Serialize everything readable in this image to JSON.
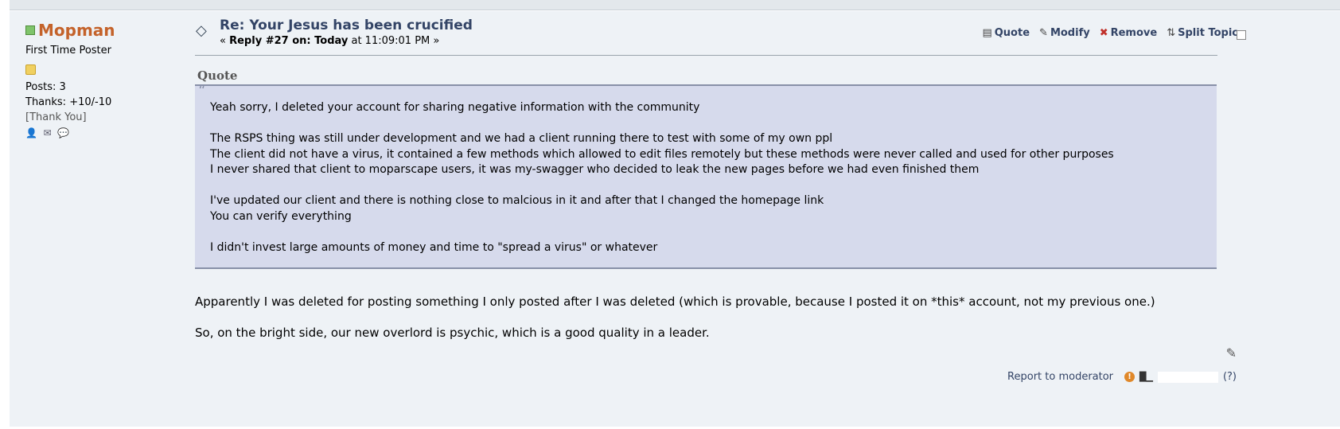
{
  "poster": {
    "name": "Mopman",
    "rank": "First Time Poster",
    "posts": "Posts: 3",
    "thanks": "Thanks: +10/-10",
    "thank_link": "[Thank You]",
    "online_color": "#7fc46b",
    "icons": [
      "profile-icon",
      "email-icon",
      "pm-icon"
    ]
  },
  "header": {
    "subject": "Re: Your Jesus has been crucified",
    "reply_prefix": "«",
    "reply_label": "Reply #27 on: Today",
    "reply_time": "at 11:09:01 PM »"
  },
  "actions": {
    "quote": "Quote",
    "modify": "Modify",
    "remove": "Remove",
    "split": "Split Topic"
  },
  "quote": {
    "header": "Quote",
    "lines": [
      "Yeah sorry, I deleted your account for sharing negative information with the community",
      "",
      "The RSPS thing was still under development and we had a client running there to test with some of my own ppl",
      "The client did not have a virus, it contained a few methods which allowed to edit files remotely but these methods were never called and used for other purposes",
      "I never shared that client to moparscape users, it was my-swagger who decided to leak the new pages before we had even finished them",
      "",
      "I've updated our client and there is nothing close to malcious in it and after that I changed the homepage link",
      "You can verify everything",
      "",
      "I didn't invest large amounts of money and time to \"spread a virus\" or whatever"
    ]
  },
  "body": {
    "paragraphs": [
      "Apparently I was deleted for posting something I only posted after I was deleted (which is provable, because I posted it on *this* account, not my previous one.)",
      "So, on the bright side, our new overlord is psychic, which is a good quality in a leader."
    ]
  },
  "footer": {
    "report": "Report to moderator",
    "help": "(?)"
  }
}
